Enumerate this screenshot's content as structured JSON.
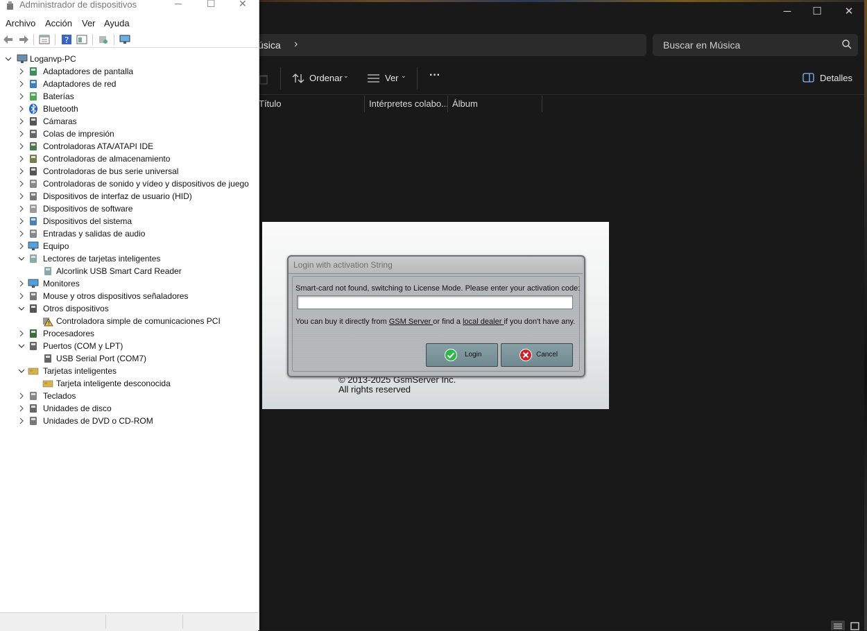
{
  "explorer": {
    "address_crumb": "úsica",
    "search_placeholder": "Buscar en Música",
    "toolbar": {
      "sort": "Ordenar",
      "view": "Ver",
      "more": "···",
      "details": "Detalles"
    },
    "columns": [
      "Título",
      "Intérpretes colabo...",
      "Álbum"
    ]
  },
  "devmgr": {
    "title": "Administrador de dispositivos",
    "menu": [
      "Archivo",
      "Acción",
      "Ver",
      "Ayuda"
    ],
    "tree": [
      {
        "label": "Loganvp-PC",
        "level": 0,
        "state": "expanded",
        "icon": "computer-icon"
      },
      {
        "label": "Adaptadores de pantalla",
        "level": 1,
        "state": "collapsed",
        "icon": "display-adapter-icon"
      },
      {
        "label": "Adaptadores de red",
        "level": 1,
        "state": "collapsed",
        "icon": "network-adapter-icon"
      },
      {
        "label": "Baterías",
        "level": 1,
        "state": "collapsed",
        "icon": "battery-icon"
      },
      {
        "label": "Bluetooth",
        "level": 1,
        "state": "collapsed",
        "icon": "bluetooth-icon"
      },
      {
        "label": "Cámaras",
        "level": 1,
        "state": "collapsed",
        "icon": "camera-icon"
      },
      {
        "label": "Colas de impresión",
        "level": 1,
        "state": "collapsed",
        "icon": "printer-icon"
      },
      {
        "label": "Controladoras ATA/ATAPI IDE",
        "level": 1,
        "state": "collapsed",
        "icon": "ide-controller-icon"
      },
      {
        "label": "Controladoras de almacenamiento",
        "level": 1,
        "state": "collapsed",
        "icon": "storage-controller-icon"
      },
      {
        "label": "Controladoras de bus serie universal",
        "level": 1,
        "state": "collapsed",
        "icon": "usb-icon"
      },
      {
        "label": "Controladoras de sonido y vídeo y dispositivos de juego",
        "level": 1,
        "state": "collapsed",
        "icon": "sound-icon"
      },
      {
        "label": "Dispositivos de interfaz de usuario (HID)",
        "level": 1,
        "state": "collapsed",
        "icon": "hid-icon"
      },
      {
        "label": "Dispositivos de software",
        "level": 1,
        "state": "collapsed",
        "icon": "software-device-icon"
      },
      {
        "label": "Dispositivos del sistema",
        "level": 1,
        "state": "collapsed",
        "icon": "system-device-icon"
      },
      {
        "label": "Entradas y salidas de audio",
        "level": 1,
        "state": "collapsed",
        "icon": "audio-io-icon"
      },
      {
        "label": "Equipo",
        "level": 1,
        "state": "collapsed",
        "icon": "monitor-icon"
      },
      {
        "label": "Lectores de tarjetas inteligentes",
        "level": 1,
        "state": "expanded",
        "icon": "smartcard-reader-icon"
      },
      {
        "label": "Alcorlink USB Smart Card Reader",
        "level": 2,
        "state": "leaf",
        "icon": "smartcard-reader-icon"
      },
      {
        "label": "Monitores",
        "level": 1,
        "state": "collapsed",
        "icon": "monitor-icon"
      },
      {
        "label": "Mouse y otros dispositivos señaladores",
        "level": 1,
        "state": "collapsed",
        "icon": "mouse-icon"
      },
      {
        "label": "Otros dispositivos",
        "level": 1,
        "state": "expanded",
        "icon": "unknown-device-icon"
      },
      {
        "label": "Controladora simple de comunicaciones PCI",
        "level": 2,
        "state": "leaf",
        "icon": "warning-device-icon"
      },
      {
        "label": "Procesadores",
        "level": 1,
        "state": "collapsed",
        "icon": "processor-icon"
      },
      {
        "label": "Puertos (COM y LPT)",
        "level": 1,
        "state": "expanded",
        "icon": "port-icon"
      },
      {
        "label": "USB Serial Port (COM7)",
        "level": 2,
        "state": "leaf",
        "icon": "port-icon"
      },
      {
        "label": "Tarjetas inteligentes",
        "level": 1,
        "state": "expanded",
        "icon": "smartcard-icon"
      },
      {
        "label": "Tarjeta inteligente desconocida",
        "level": 2,
        "state": "leaf",
        "icon": "smartcard-icon"
      },
      {
        "label": "Teclados",
        "level": 1,
        "state": "collapsed",
        "icon": "keyboard-icon"
      },
      {
        "label": "Unidades de disco",
        "level": 1,
        "state": "collapsed",
        "icon": "disk-drive-icon"
      },
      {
        "label": "Unidades de DVD o CD-ROM",
        "level": 1,
        "state": "collapsed",
        "icon": "dvd-drive-icon"
      }
    ]
  },
  "login": {
    "title": "Login with activation String",
    "message": "Smart-card not found, switching to License Mode. Please enter your activation code:",
    "activation_value": "",
    "buy_prefix": "You can buy it directly from ",
    "buy_link1": "GSM Server ",
    "buy_mid": "or find a ",
    "buy_link2": "local dealer ",
    "buy_suffix": "if you don't have any.",
    "login_label": "Login",
    "cancel_label": "Cancel",
    "copyright": "© 2013-2025 GsmServer Inc.",
    "rights": "All rights reserved"
  },
  "colors": {
    "explorer_bg": "#191919",
    "dialog_button": "#7c959b",
    "ok_green": "#2eb84a",
    "cancel_red": "#d0202a"
  }
}
